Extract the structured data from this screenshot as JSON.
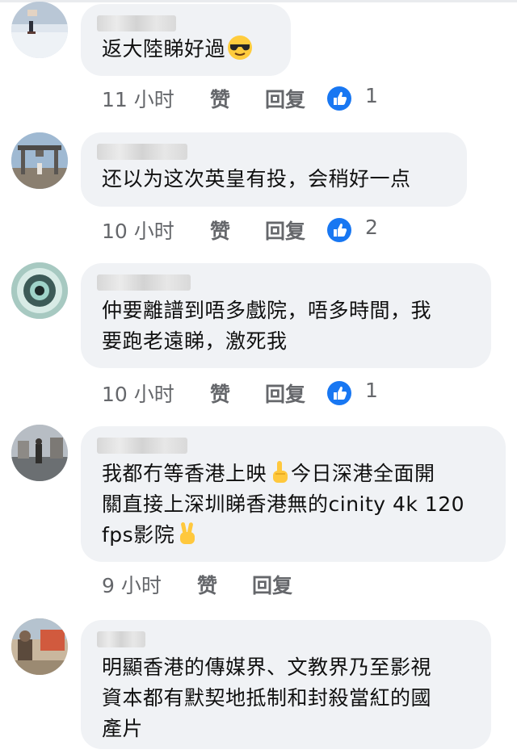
{
  "colors": {
    "like_blue": "#1877f2",
    "bubble_bg": "#f0f2f5",
    "meta_gray": "#65676b"
  },
  "comments": [
    {
      "text": "返大陸睇好過",
      "emoji": "sunglasses-face",
      "time": "11 小时",
      "like_label": "赞",
      "reply_label": "回复",
      "reaction_icon": "like-thumb",
      "reaction_count": "1"
    },
    {
      "text": "还以为这次英皇有投，会稍好一点",
      "time": "10 小时",
      "like_label": "赞",
      "reply_label": "回复",
      "reaction_icon": "like-thumb",
      "reaction_count": "2"
    },
    {
      "text_line1": "仲要離譜到唔多戲院，唔多時間，我",
      "text_line2": "要跑老遠睇，激死我",
      "time": "10 小时",
      "like_label": "赞",
      "reply_label": "回复",
      "reaction_icon": "like-thumb",
      "reaction_count": "1"
    },
    {
      "text_line1": "我都冇等香港上映",
      "text_line1b": "今日深港全面開",
      "text_line2": "關直接上深圳睇香港無的cinity 4k 120",
      "text_line3": "fps影院",
      "emoji1": "index-pointing-up",
      "emoji2": "victory-hand",
      "time": "9 小时",
      "like_label": "赞",
      "reply_label": "回复"
    },
    {
      "text_line1": "明顯香港的傳媒界、文教界乃至影視",
      "text_line2": "資本都有默契地抵制和封殺當紅的國",
      "text_line3": "產片"
    }
  ]
}
